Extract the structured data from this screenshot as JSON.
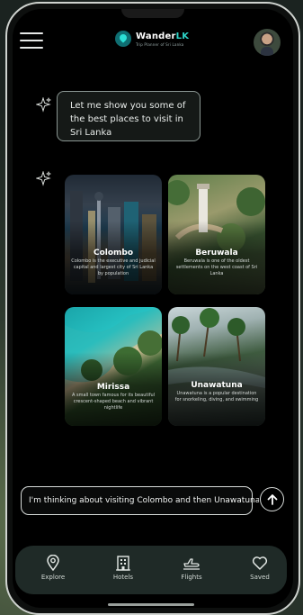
{
  "app": {
    "brand_main": "Wander",
    "brand_accent": "LK",
    "brand_tagline": "Trip Planner of Sri Lanka",
    "accent_color": "#2dd4c8"
  },
  "chat": {
    "bot_message": "Let me show you some of the best places to visit in Sri Lanka",
    "places": [
      {
        "name": "Colombo",
        "description": "Colombo is the executive and judicial capital and largest city of Sri Lanka by population"
      },
      {
        "name": "Beruwala",
        "description": "Beruwala is one of the oldest settlements on the west coast of Sri Lanka"
      },
      {
        "name": "Mirissa",
        "description": "A small town famous for its beautiful crescent-shaped beach and vibrant nightlife"
      },
      {
        "name": "Unawatuna",
        "description": "Unawatuna is a popular destination for snorkeling, diving, and swimming"
      }
    ],
    "input_value": "I'm thinking about visiting Colombo and then Unawatuna"
  },
  "nav": {
    "items": [
      {
        "label": "Explore",
        "icon": "map-pin-icon"
      },
      {
        "label": "Hotels",
        "icon": "hotel-icon"
      },
      {
        "label": "Flights",
        "icon": "plane-icon"
      },
      {
        "label": "Saved",
        "icon": "heart-icon"
      }
    ]
  }
}
